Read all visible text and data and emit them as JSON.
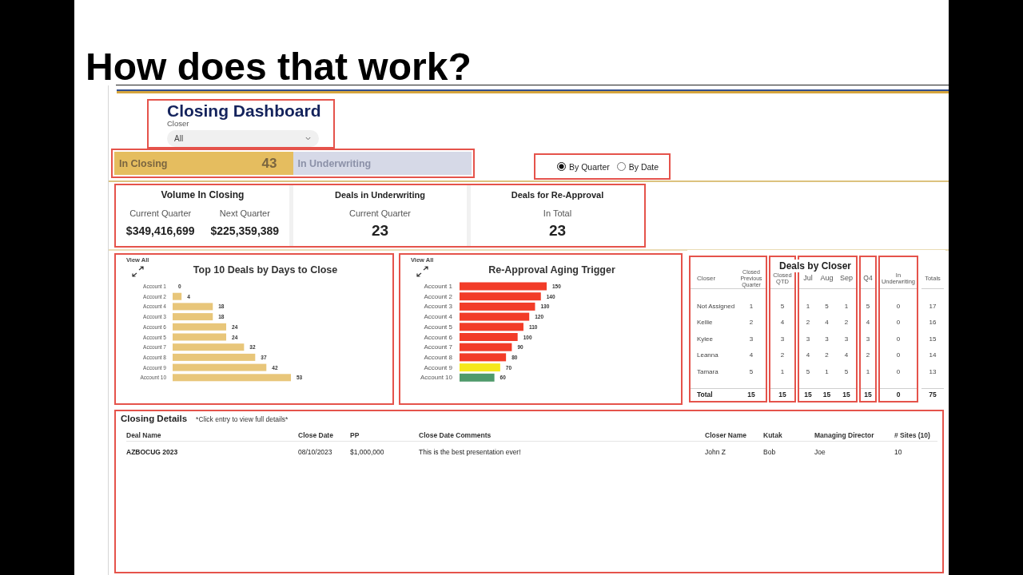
{
  "slide": {
    "title": "How does that work?"
  },
  "dashboard": {
    "header": {
      "highlighted": true,
      "title": "Closing Dashboard",
      "filter": {
        "label": "Closer",
        "value": "All"
      }
    },
    "status_tabs": {
      "highlighted": true,
      "tabs": [
        {
          "label": "In Closing",
          "count": "43",
          "selected": true
        },
        {
          "label": "In Underwriting",
          "selected": false
        }
      ]
    },
    "period_options": {
      "highlighted": true,
      "options": [
        {
          "label": "By Quarter",
          "selected": true
        },
        {
          "label": "By Date",
          "selected": false
        }
      ]
    },
    "kpis": {
      "highlighted": true,
      "cards": [
        {
          "title": "Volume In Closing",
          "metrics": [
            {
              "label": "Current Quarter",
              "value": "$349,416,699"
            },
            {
              "label": "Next Quarter",
              "value": "$225,359,389"
            }
          ]
        },
        {
          "title": "Deals in Underwriting",
          "metrics": [
            {
              "label": "Current Quarter",
              "value": "23"
            }
          ]
        },
        {
          "title": "Deals for Re-Approval",
          "metrics": [
            {
              "label": "In Total",
              "value": "23"
            }
          ]
        }
      ]
    },
    "charts": [
      {
        "highlighted": true,
        "view_all": "View All",
        "chart_data": {
          "type": "bar",
          "orientation": "horizontal",
          "title": "Top 10 Deals by Days to Close",
          "categories": [
            "Account 1",
            "Account 2",
            "Account 4",
            "Account 3",
            "Account 6",
            "Account 5",
            "Account 7",
            "Account 8",
            "Account 9",
            "Account 10"
          ],
          "values": [
            0,
            4,
            18,
            18,
            24,
            24,
            32,
            37,
            42,
            53
          ],
          "color": "#e8c67a",
          "data_labels": true
        }
      },
      {
        "highlighted": true,
        "view_all": "View All",
        "chart_data": {
          "type": "bar",
          "orientation": "horizontal",
          "title": "Re-Approval Aging Trigger",
          "categories": [
            "Account 1",
            "Account 2",
            "Account 3",
            "Account 4",
            "Account 5",
            "Account 6",
            "Account 7",
            "Account 8",
            "Account 9",
            "Account 10"
          ],
          "values": [
            150,
            140,
            130,
            120,
            110,
            100,
            90,
            80,
            70,
            60
          ],
          "colors": [
            "#f23c28",
            "#f23c28",
            "#f23c28",
            "#f23c28",
            "#f23c28",
            "#f23c28",
            "#f23c28",
            "#f23c28",
            "#f5e81c",
            "#4f9a6b"
          ],
          "data_labels": true
        }
      }
    ],
    "deals_by_closer": {
      "title": "Deals by Closer",
      "column_groups": [
        {
          "highlighted": true,
          "columns": [
            "Closer",
            "Closed Previous Quarter"
          ]
        },
        {
          "highlighted": true,
          "columns": [
            "Closed QTD"
          ]
        },
        {
          "highlighted": true,
          "columns": [
            "Jul",
            "Aug",
            "Sep"
          ]
        },
        {
          "highlighted": true,
          "columns": [
            "Q4"
          ]
        },
        {
          "highlighted": true,
          "columns": [
            "In Underwriting"
          ]
        },
        {
          "highlighted": false,
          "columns": [
            "Totals"
          ]
        }
      ],
      "rows": [
        [
          "Not Assigned",
          "1",
          "5",
          "1",
          "5",
          "1",
          "5",
          "0",
          "17"
        ],
        [
          "Kellie",
          "2",
          "4",
          "2",
          "4",
          "2",
          "4",
          "0",
          "16"
        ],
        [
          "Kylee",
          "3",
          "3",
          "3",
          "3",
          "3",
          "3",
          "0",
          "15"
        ],
        [
          "Leanna",
          "4",
          "2",
          "4",
          "2",
          "4",
          "2",
          "0",
          "14"
        ],
        [
          "Tamara",
          "5",
          "1",
          "5",
          "1",
          "5",
          "1",
          "0",
          "13"
        ]
      ],
      "total_row": [
        "Total",
        "15",
        "15",
        "15",
        "15",
        "15",
        "15",
        "0",
        "75"
      ]
    },
    "closing_details": {
      "highlighted": true,
      "title": "Closing Details",
      "note": "*Click entry to view full details*",
      "columns": [
        "Deal Name",
        "Close Date",
        "PP",
        "Close Date Comments",
        "Closer Name",
        "Kutak",
        "Managing Director",
        "# Sites (10)"
      ],
      "rows": [
        [
          "AZBOCUG 2023",
          "08/10/2023",
          "$1,000,000",
          "This is the best presentation ever!",
          "John Z",
          "Bob",
          "Joe",
          "10"
        ]
      ]
    }
  }
}
